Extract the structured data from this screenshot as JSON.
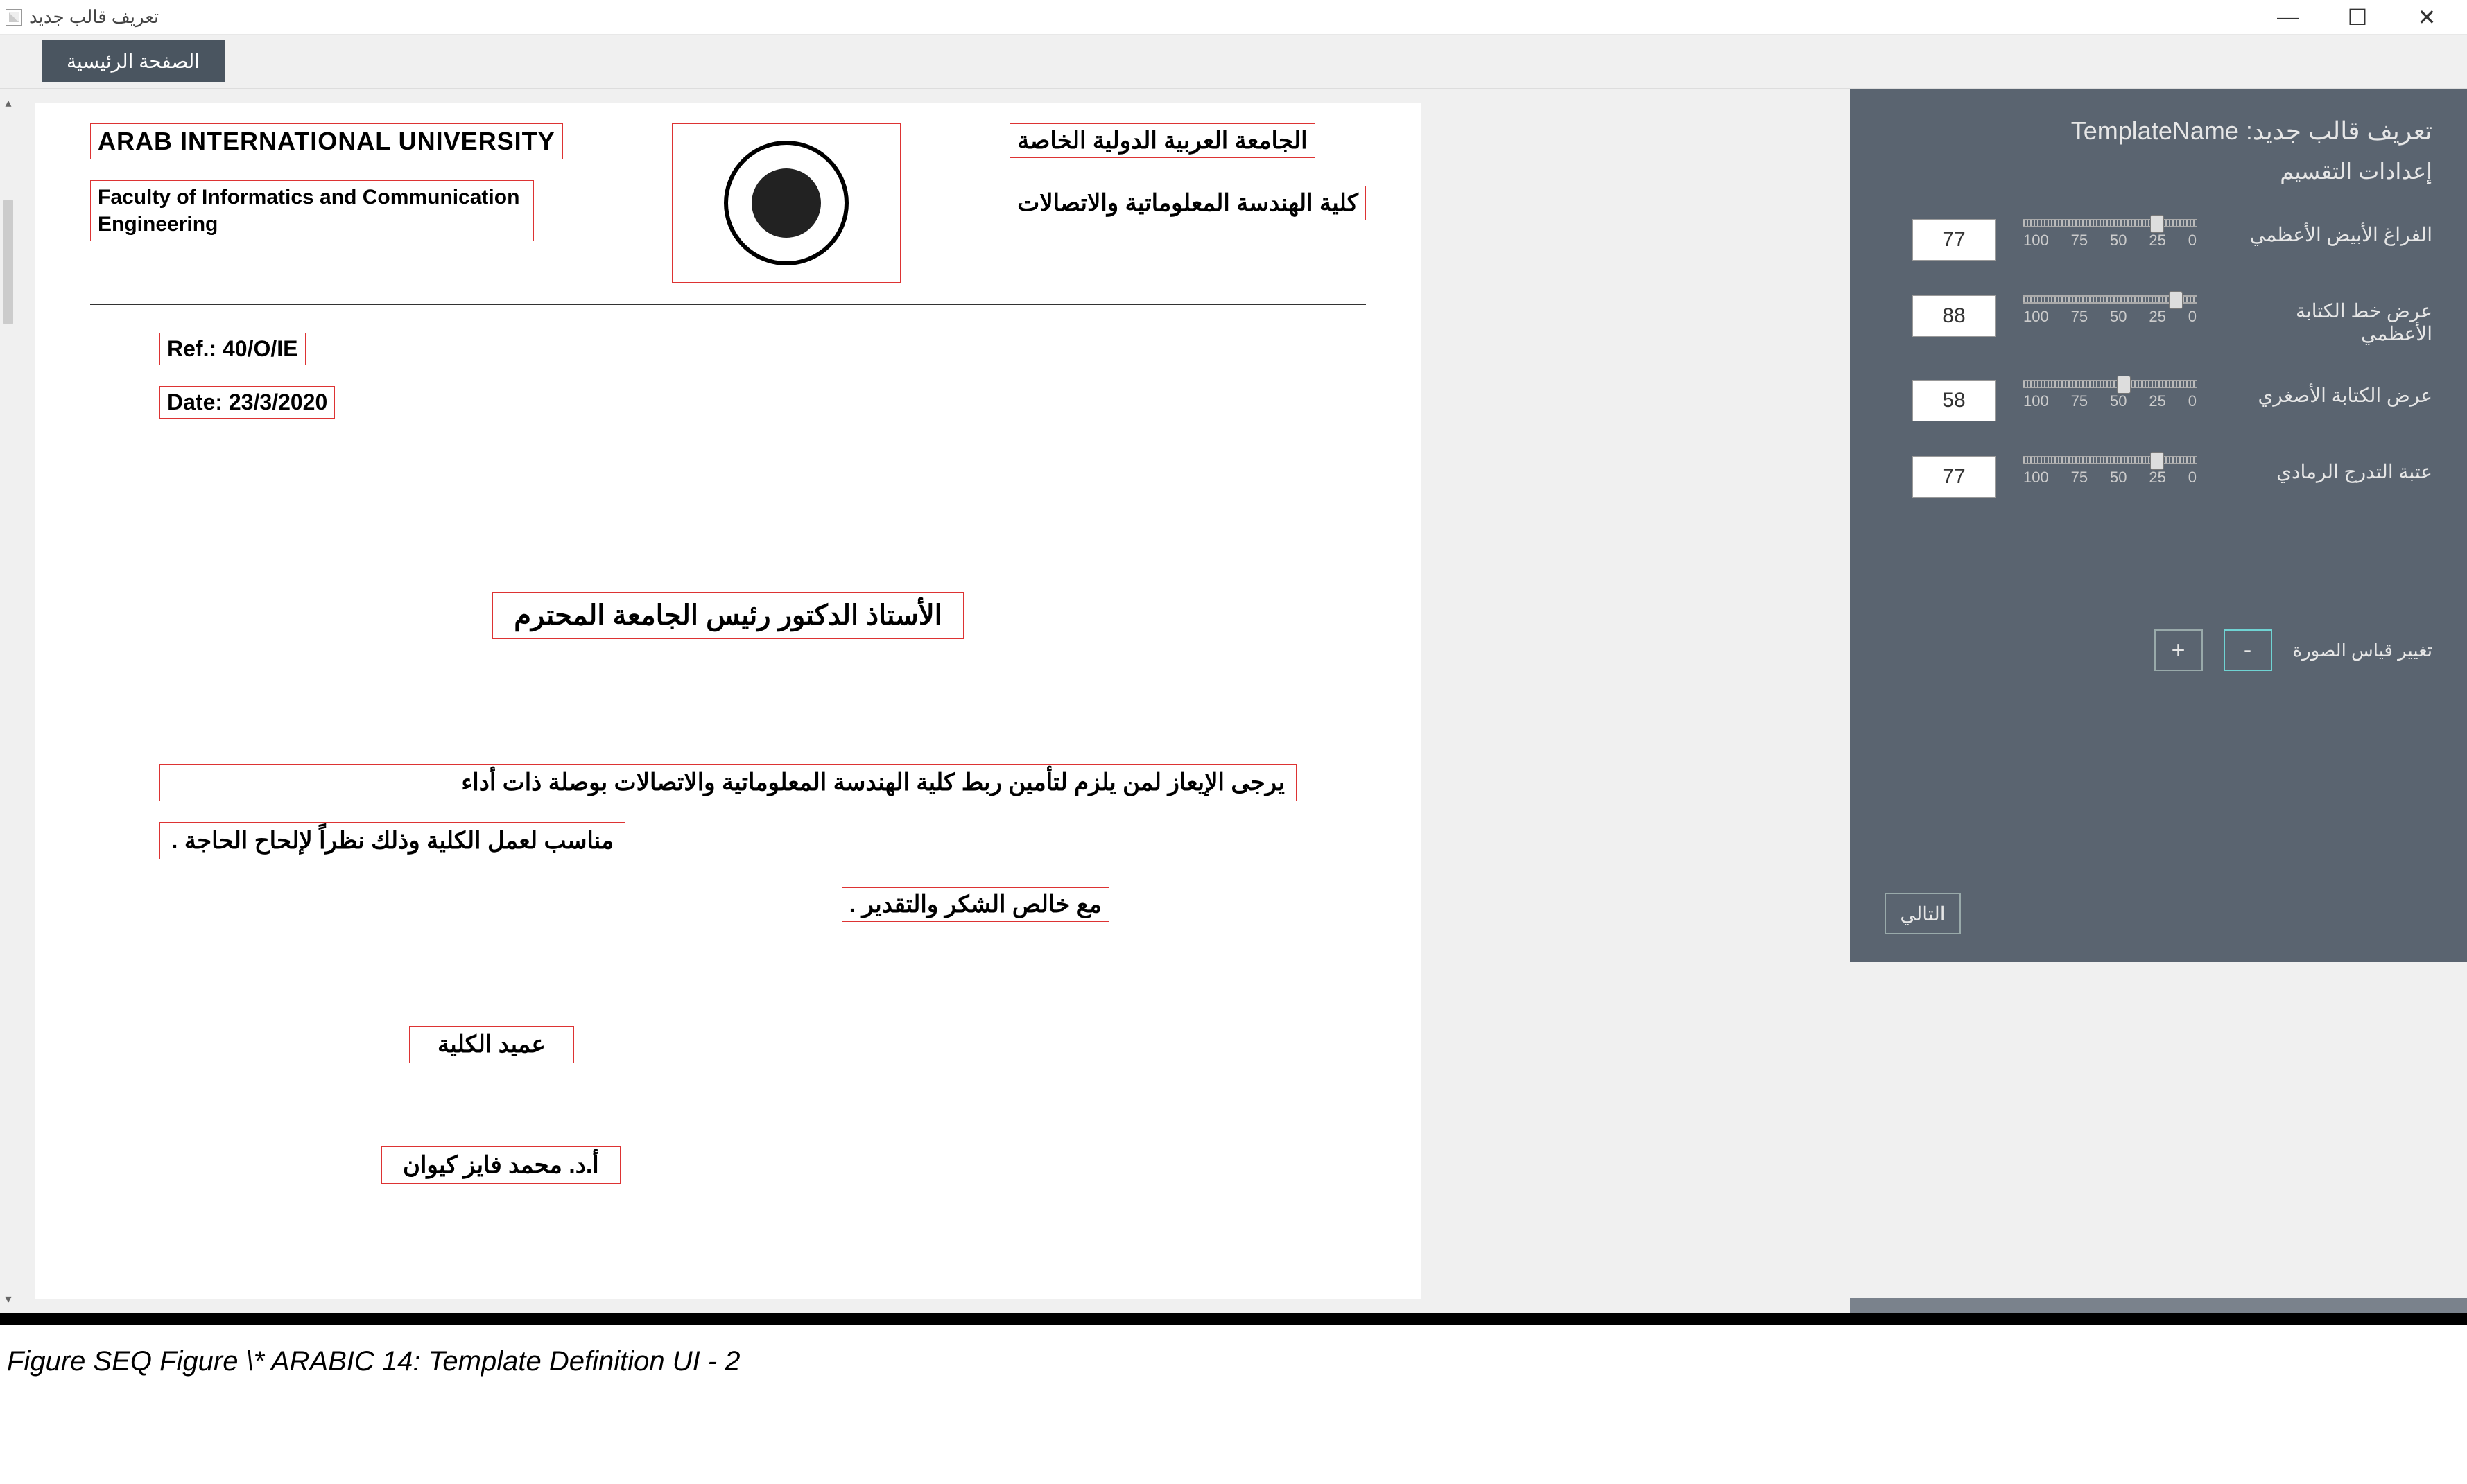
{
  "window": {
    "title": "تعريف قالب جديد"
  },
  "toolbar": {
    "home_label": "الصفحة الرئيسية"
  },
  "document": {
    "eng_title": "ARAB   INTERNATIONAL UNIVERSITY",
    "eng_faculty": "Faculty of Informatics and Communication Engineering",
    "ar_title": "الجامعة العربية الدولية الخاصة",
    "ar_faculty": "كلية الهندسة المعلوماتية والاتصالات",
    "ref": "Ref.:   40/O/IE",
    "date": "Date:  23/3/2020",
    "salutation": "الأستاذ الدكتور رئيس الجامعة المحترم",
    "body_line1": "يرجى الإيعاز لمن يلزم لتأمين ربط كلية الهندسة المعلوماتية والاتصالات بوصلة ذات أداء",
    "body_line2": "مناسب لعمل الكلية وذلك نظراً لإلحاح الحاجة .",
    "closing": "مع خالص الشكر والتقدير .",
    "signature_title": "عميد الكلية",
    "signer_name": "أ.د. محمد فايز كيوان"
  },
  "panel": {
    "title_prefix": "تعريف قالب جديد:",
    "template_name": "TemplateName",
    "section_label": "إعدادات التقسيم",
    "sliders": [
      {
        "label": "الفراغ الأبيض الأعظمي",
        "value": "77"
      },
      {
        "label": "عرض خط الكتابة الأعظمي",
        "value": "88"
      },
      {
        "label": "عرض الكتابة الأصغري",
        "value": "58"
      },
      {
        "label": "عتبة التدرج الرمادي",
        "value": "77"
      }
    ],
    "tick_labels": [
      "0",
      "25",
      "50",
      "75",
      "100"
    ],
    "scale_label": "تغيير قياس الصورة",
    "plus": "+",
    "minus": "-",
    "next": "التالي"
  },
  "caption": "Figure  SEQ Figure \\* ARABIC 14: Template Definition UI - 2"
}
